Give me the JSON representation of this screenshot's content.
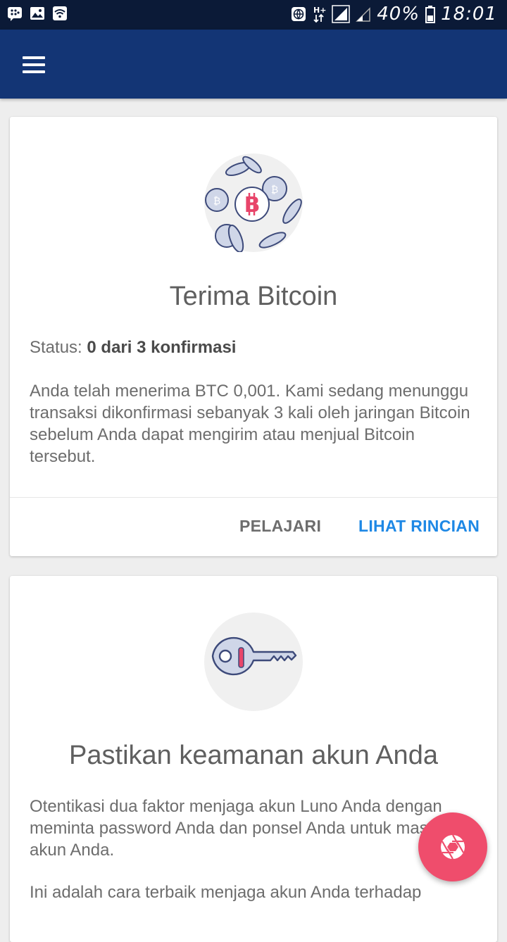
{
  "status_bar": {
    "battery": "40%",
    "time": "18:01",
    "left_icons": [
      "bbm-icon",
      "image-icon",
      "wifi-icon"
    ],
    "right_icons": [
      "vpn-globe-icon",
      "data-icon",
      "signal-icon",
      "battery-icon"
    ]
  },
  "app_bar": {
    "menu_icon": "menu-icon"
  },
  "cards": [
    {
      "illustration": "bitcoin-coins-icon",
      "title": "Terima Bitcoin",
      "status_label": "Status:",
      "status_value": "0 dari 3 konfirmasi",
      "body": "Anda telah menerima BTC 0,001. Kami sedang menunggu transaksi dikonfirmasi sebanyak 3 kali oleh jaringan Bitcoin sebelum Anda dapat mengirim atau menjual Bitcoin tersebut.",
      "action_learn": "PELAJARI",
      "action_details": "LIHAT RINCIAN"
    },
    {
      "illustration": "key-icon",
      "title": "Pastikan keamanan akun Anda",
      "body1": "Otentikasi dua faktor menjaga akun Luno Anda dengan meminta password Anda dan ponsel Anda untuk masuk ke akun Anda.",
      "body2": "Ini adalah cara terbaik menjaga akun Anda terhadap"
    }
  ],
  "fab": {
    "icon": "aperture-icon"
  },
  "colors": {
    "status_bar": "#0b1a37",
    "app_bar": "#133575",
    "accent_blue": "#1e88e5",
    "fab": "#ef4d6c",
    "bitcoin_red": "#e8456a"
  }
}
